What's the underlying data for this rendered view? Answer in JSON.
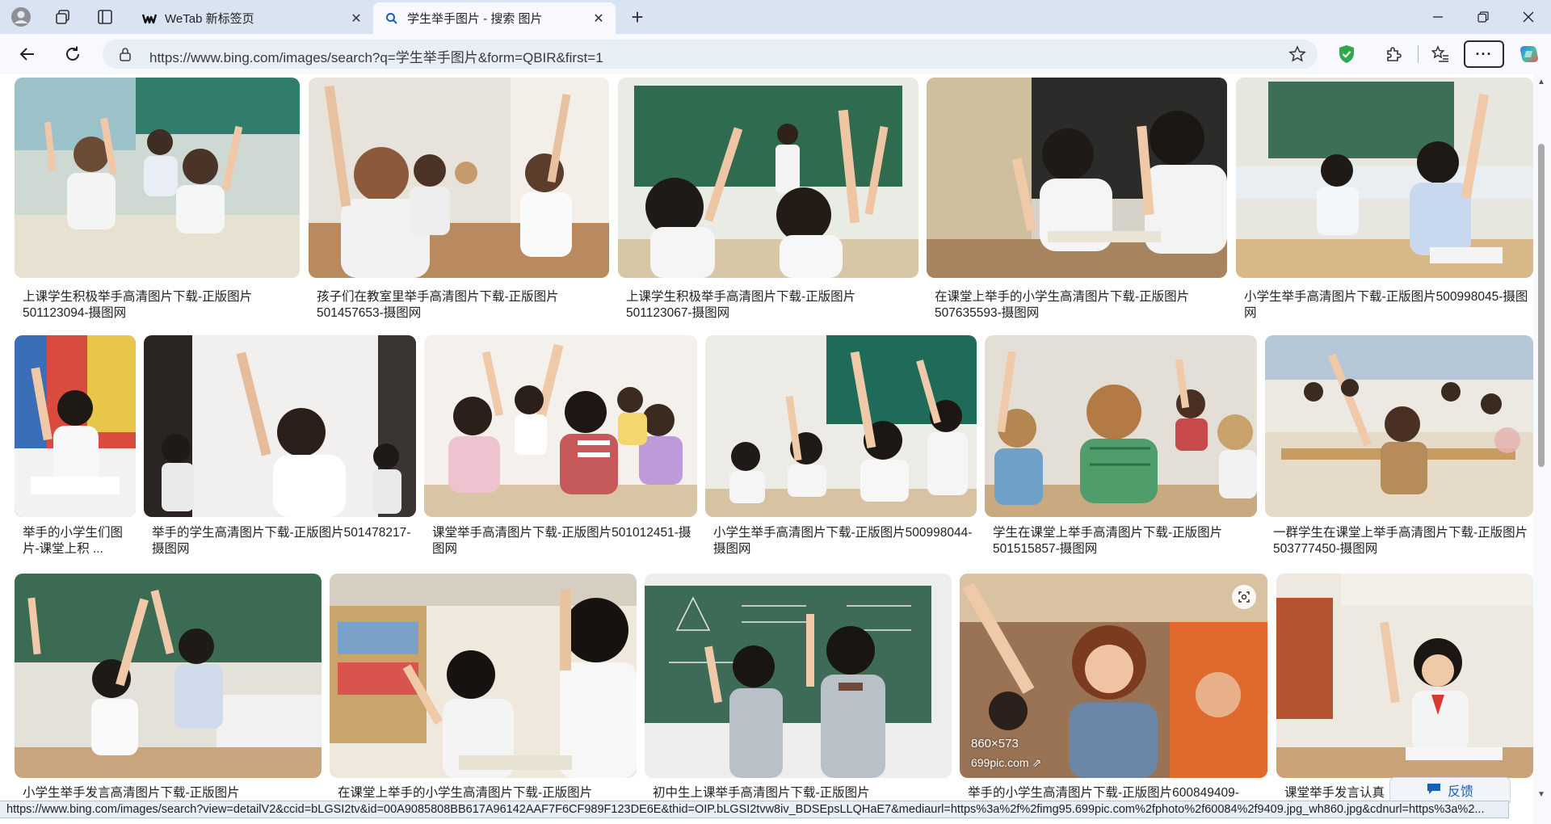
{
  "browser": {
    "tabs": [
      {
        "title": "WeTab 新标签页",
        "active": false
      },
      {
        "title": "学生举手图片 - 搜索 图片",
        "active": true
      }
    ],
    "new_tab_label": "+",
    "address": "https://www.bing.com/images/search?q=学生举手图片&form=QBIR&first=1",
    "more_label": "···"
  },
  "results": [
    {
      "caption": "上课学生积极举手高清图片下载-正版图片501123094-摄图网"
    },
    {
      "caption": "孩子们在教室里举手高清图片下载-正版图片501457653-摄图网"
    },
    {
      "caption": "上课学生积极举手高清图片下载-正版图片501123067-摄图网"
    },
    {
      "caption": "在课堂上举手的小学生高清图片下载-正版图片507635593-摄图网"
    },
    {
      "caption": "小学生举手高清图片下载-正版图片500998045-摄图网"
    },
    {
      "caption": "举手的小学生们图片-课堂上积 ..."
    },
    {
      "caption": "举手的学生高清图片下载-正版图片501478217-摄图网"
    },
    {
      "caption": "课堂举手高清图片下载-正版图片501012451-摄图网"
    },
    {
      "caption": "小学生举手高清图片下载-正版图片500998044-摄图网"
    },
    {
      "caption": "学生在课堂上举手高清图片下载-正版图片501515857-摄图网"
    },
    {
      "caption": "一群学生在课堂上举手高清图片下载-正版图片503777450-摄图网"
    },
    {
      "caption": "小学生举手发言高清图片下载-正版图片"
    },
    {
      "caption": "在课堂上举手的小学生高清图片下载-正版图片"
    },
    {
      "caption": "初中生上课举手高清图片下载-正版图片"
    },
    {
      "caption": "举手的小学生高清图片下载-正版图片600849409-",
      "size": "860×573",
      "source": "699pic.com"
    },
    {
      "caption": "课堂举手发言认真"
    }
  ],
  "status_url": "https://www.bing.com/images/search?view=detailV2&ccid=bLGSI2tv&id=00A9085808BB617A96142AAF7F6CF989F123DE6E&thid=OIP.bLGSI2tvw8iv_BDSEpsLLQHaE7&mediaurl=https%3a%2f%2fimg95.699pic.com%2fphoto%2f60084%2f9409.jpg_wh860.jpg&cdnurl=https%3a%2...",
  "feedback_label": "反馈",
  "colors": {
    "accent": "#1a5fb4",
    "tabstrip": "#d9e3f1",
    "active_tab": "#f7f9fc"
  }
}
